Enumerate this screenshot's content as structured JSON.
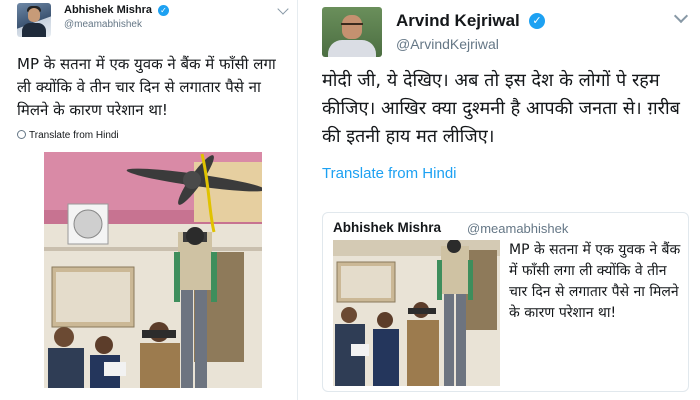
{
  "left_tweet": {
    "author_name": "Abhishek Mishra",
    "handle": "@meamabhishek",
    "text": "MP के सतना में एक युवक ने बैंक में फाँसी लगा ली क्योंकि वे तीन चार दिन से लगातार पैसे ना मिलने के कारण परेशान था!",
    "translate_label": "Translate from Hindi",
    "verified_icon": "verified-badge-icon",
    "photo_icon": "tweet-photo"
  },
  "right_tweet": {
    "author_name": "Arvind Kejriwal",
    "handle": "@ArvindKejriwal",
    "text": "मोदी जी, ये देखिए। अब तो इस देश के लोगों पे रहम कीजिए। आखिर क्या दुश्मनी है आपकी जनता से। ग़रीब की इतनी हाय मत लीजिए।",
    "translate_label": "Translate from Hindi",
    "verified_icon": "verified-badge-icon"
  },
  "quoted_tweet": {
    "author_name": "Abhishek Mishra",
    "handle": "@meamabhishek",
    "text": "MP के सतना में एक युवक ने बैंक में फाँसी लगा ली क्योंकि वे तीन चार दिन से लगातार पैसे ना मिलने के कारण परेशान था!"
  },
  "colors": {
    "link_blue": "#1da1f2",
    "handle_gray": "#657786",
    "text_dark": "#14171a",
    "border": "#e1e8ed"
  }
}
